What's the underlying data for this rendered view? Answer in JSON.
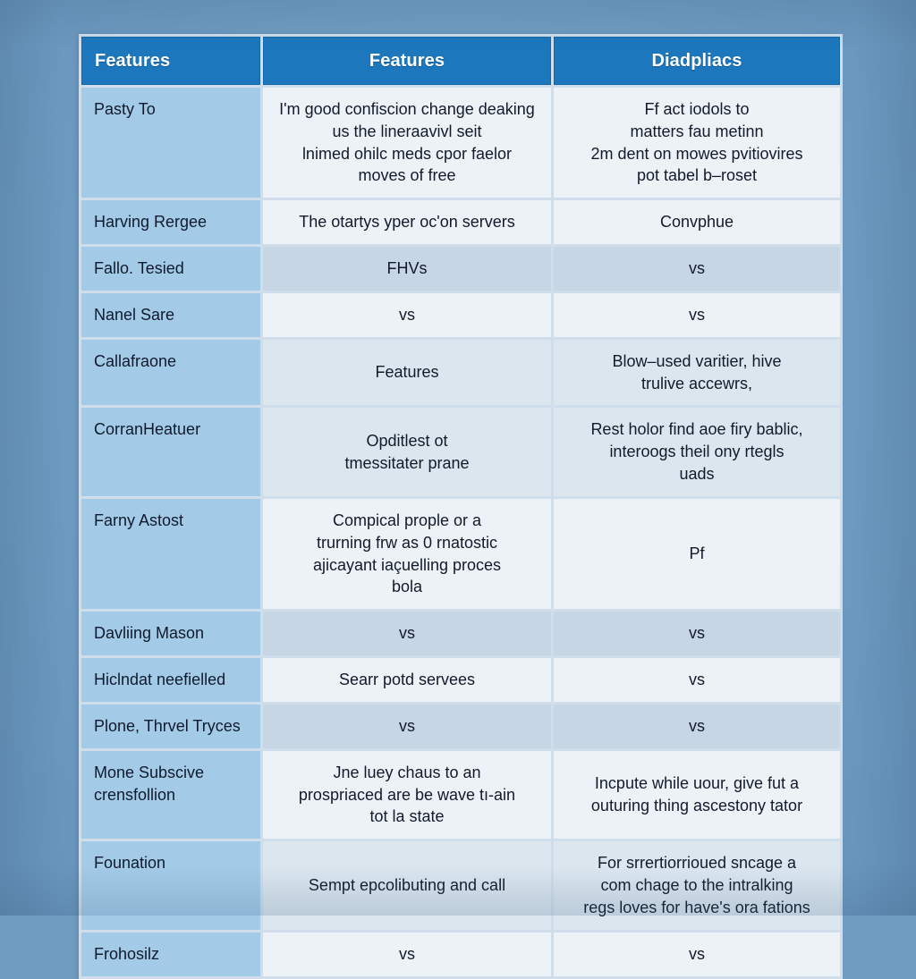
{
  "table": {
    "headers": {
      "col1": "Features",
      "col2": "Features",
      "col3": "Diadpliacs"
    },
    "rows": [
      {
        "label": "Pasty To",
        "col2": "I'm good confiscion change deaking\nus the lineraavivl seit\nlnimed ohilc meds cpor faelor\nmoves of free",
        "col3": "Ff act iodols to\nmatters fau metinn\n2m dent on mowes pvitiovires\npot tabel b–roset",
        "band": "b"
      },
      {
        "label": "Harving Rergee",
        "col2": "The otartys yper oc'on servers",
        "col3": "Convphue",
        "band": "b"
      },
      {
        "label": "Fallo. Tesied",
        "col2": "FHVs",
        "col3": "vs",
        "band": "a"
      },
      {
        "label": "Nanel Sare",
        "col2": "vs",
        "col3": "vs",
        "band": "b"
      },
      {
        "label": "Callafraone",
        "col2": "Features",
        "col3": "Blow–used varitier, hive\ntrulive accewrs,",
        "band": "c"
      },
      {
        "label": "CorranHeatuer",
        "col2": "Opditlest ot\ntmessitater prane",
        "col3": "Rest holor find aoe firy bablic,\ninteroogs theil ony rtegls\nuads",
        "band": "c"
      },
      {
        "label": "Farny Astost",
        "col2": "Compical prople or a\ntrurning frw as 0 rnatostic\najicayant iaçuelling proces\nbola",
        "col3": "Pf",
        "band": "b"
      },
      {
        "label": "Davliing Mason",
        "col2": "vs",
        "col3": "vs",
        "band": "a"
      },
      {
        "label": "Hiclndat neefielled",
        "col2": "Searr potd servees",
        "col3": "vs",
        "band": "b"
      },
      {
        "label": "Plone, Thrvel Tryces",
        "col2": "vs",
        "col3": "vs",
        "band": "a"
      },
      {
        "label": "Mone Subscive\ncrensfollion",
        "col2": "Jne luey chaus to an\nprospriaced are be wave tı-ain\ntot la state",
        "col3": "Incpute while uour, give fut a\nouturing thing ascestony tator",
        "band": "b"
      },
      {
        "label": "Founation",
        "col2": "Sempt epcolibuting and call",
        "col3": "For srrertiorrioued sncage a\ncom chage to the intralking\nregs loves for have's ora fations",
        "band": "c"
      },
      {
        "label": "Frohosilz",
        "col2": "vs",
        "col3": "vs",
        "band": "b"
      }
    ]
  },
  "colors": {
    "page_background": "#6e9bc1",
    "header_blue": "#1c77bd",
    "label_column": "#a3cbe8",
    "band_dark": "#c6d6e4",
    "band_light": "#edf2f7",
    "band_mid": "#dbe6ef",
    "text": "#121a2b",
    "header_text": "#ffffff"
  }
}
